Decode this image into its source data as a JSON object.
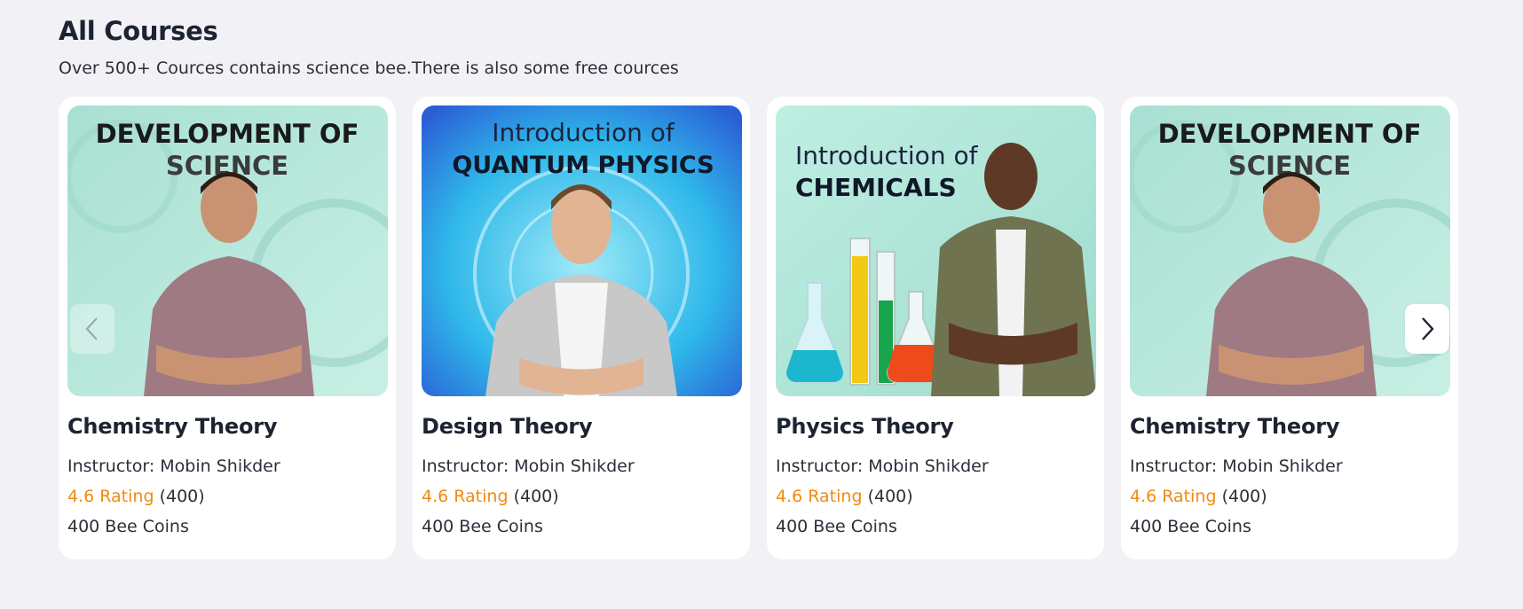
{
  "header": {
    "title": "All Courses",
    "subtitle": "Over 500+ Cources contains science bee.There is also some free cources"
  },
  "courses": [
    {
      "banner_line1": "DEVELOPMENT OF",
      "banner_line2": "SCIENCE",
      "title": "Chemistry Theory",
      "instructor": "Instructor: Mobin Shikder",
      "rating": "4.6 Rating",
      "reviews": "(400)",
      "price": "400 Bee Coins"
    },
    {
      "banner_line1": "Introduction of",
      "banner_line2": "QUANTUM PHYSICS",
      "title": "Design Theory",
      "instructor": "Instructor: Mobin Shikder",
      "rating": "4.6 Rating",
      "reviews": "(400)",
      "price": "400 Bee Coins"
    },
    {
      "banner_line1": "Introduction of",
      "banner_line2": "CHEMICALS",
      "title": "Physics Theory",
      "instructor": "Instructor: Mobin Shikder",
      "rating": "4.6 Rating",
      "reviews": "(400)",
      "price": "400 Bee Coins"
    },
    {
      "banner_line1": "DEVELOPMENT OF",
      "banner_line2": "SCIENCE",
      "title": "Chemistry Theory",
      "instructor": "Instructor: Mobin Shikder",
      "rating": "4.6 Rating",
      "reviews": "(400)",
      "price": "400 Bee Coins"
    }
  ],
  "carousel": {
    "prev_icon": "chevron-left-icon",
    "next_icon": "chevron-right-icon"
  },
  "colors": {
    "page_background": "#f2f2f6",
    "rating_accent": "#f08a12",
    "card_background": "#ffffff"
  }
}
